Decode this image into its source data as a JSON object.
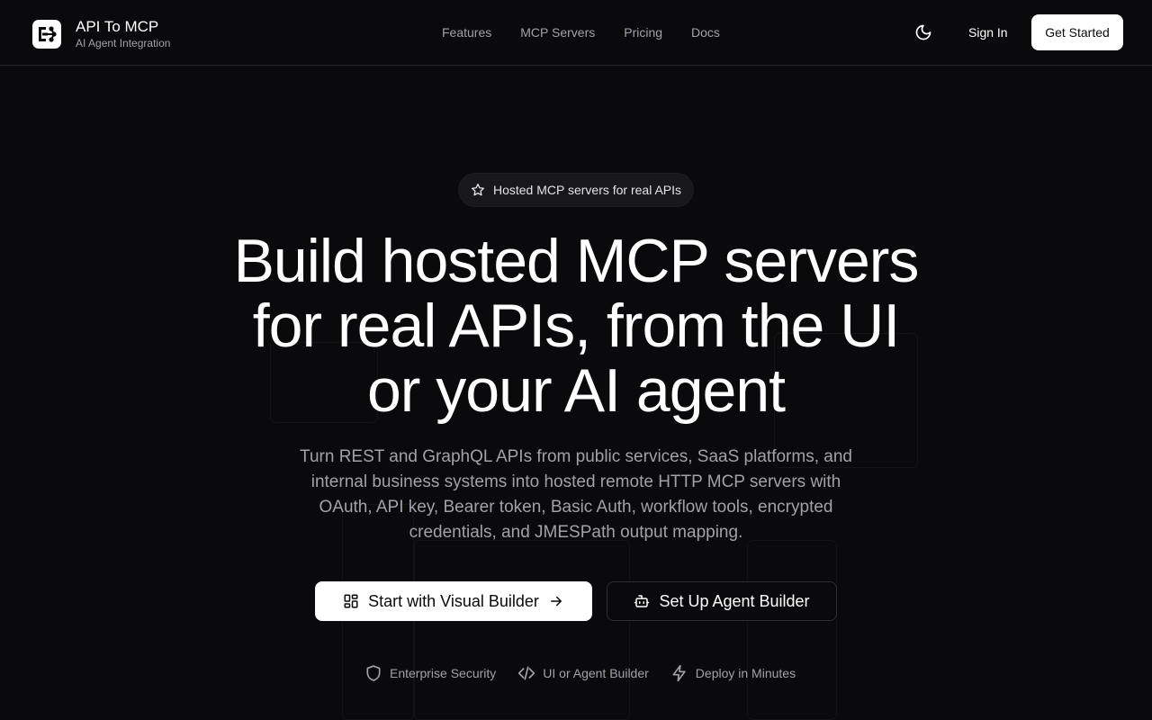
{
  "brand": {
    "title": "API To MCP",
    "subtitle": "AI Agent Integration",
    "logo_icon": "api-to-mcp-logo-icon"
  },
  "nav": {
    "items": [
      {
        "label": "Features"
      },
      {
        "label": "MCP Servers"
      },
      {
        "label": "Pricing"
      },
      {
        "label": "Docs"
      }
    ]
  },
  "header_actions": {
    "theme_icon": "moon-icon",
    "sign_in": "Sign In",
    "get_started": "Get Started"
  },
  "hero": {
    "badge": "Hosted MCP servers for real APIs",
    "headline_lines": [
      "Build hosted MCP servers",
      "for real APIs, from the UI",
      "or your AI agent"
    ],
    "subtitle_lines": [
      "Turn REST and GraphQL APIs from public services, SaaS platforms, and",
      "internal business systems into hosted remote HTTP MCP servers with",
      "OAuth, API key, Bearer token, Basic Auth, workflow tools, encrypted",
      "credentials, and JMESPath output mapping."
    ],
    "primary_cta": "Start with Visual Builder",
    "secondary_cta": "Set Up Agent Builder",
    "features": [
      {
        "label": "Enterprise Security",
        "icon": "shield-icon"
      },
      {
        "label": "UI or Agent Builder",
        "icon": "code-icon"
      },
      {
        "label": "Deploy in Minutes",
        "icon": "lightning-icon"
      }
    ]
  },
  "colors": {
    "background": "#0a0a0c",
    "foreground": "#ffffff",
    "muted": "#a1a1aa",
    "border": "#27272a"
  }
}
